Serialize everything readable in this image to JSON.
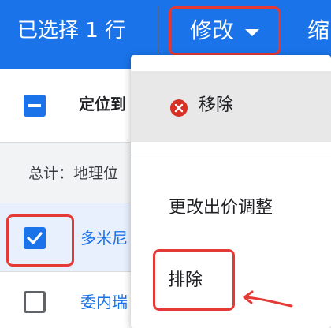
{
  "topbar": {
    "selected_text": "已选择 1 行",
    "modify_label": "修改",
    "shrink_label": "缩"
  },
  "table": {
    "column_header": "定位到",
    "total_label": "总计：地理位",
    "rows": [
      {
        "name": "多米尼",
        "selected": true
      },
      {
        "name": "委内瑞",
        "selected": false
      }
    ]
  },
  "menu": {
    "items": [
      {
        "label": "移除",
        "icon": "close-circle-icon"
      },
      {
        "label": "更改出价调整"
      },
      {
        "label": "排除"
      }
    ]
  },
  "colors": {
    "brand_blue": "#1a73e8",
    "highlight_red": "#e53935",
    "remove_icon_red": "#d93025"
  }
}
